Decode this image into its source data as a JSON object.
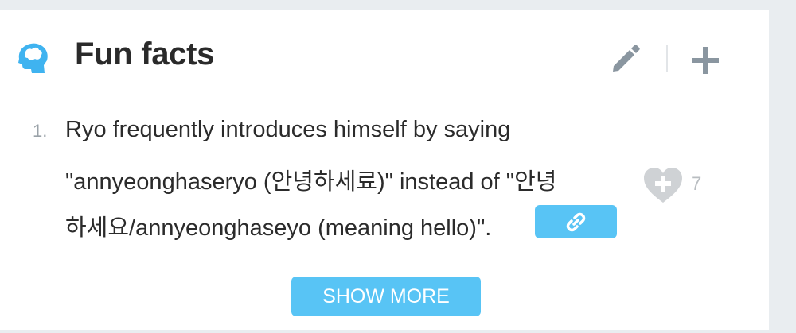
{
  "section": {
    "title": "Fun facts",
    "icon": "head-brain-icon",
    "edit_icon": "pencil-icon",
    "add_icon": "plus-icon"
  },
  "facts": [
    {
      "number": "1.",
      "lines": [
        "Ryo frequently introduces himself by saying",
        "\"annyeonghaseryo (안녕하세료)\" instead of \"안녕",
        "하세요/annyeonghaseyo (meaning hello)\"."
      ],
      "link_icon": "link-icon",
      "like_icon": "heart-plus-icon",
      "likes": "7"
    }
  ],
  "show_more_label": "SHOW MORE",
  "colors": {
    "accent": "#58c4f5",
    "icon_blue": "#3fb3f0",
    "muted_icon": "#8a96a0",
    "heart": "#cfd2d5",
    "text": "#2b2b2b"
  }
}
